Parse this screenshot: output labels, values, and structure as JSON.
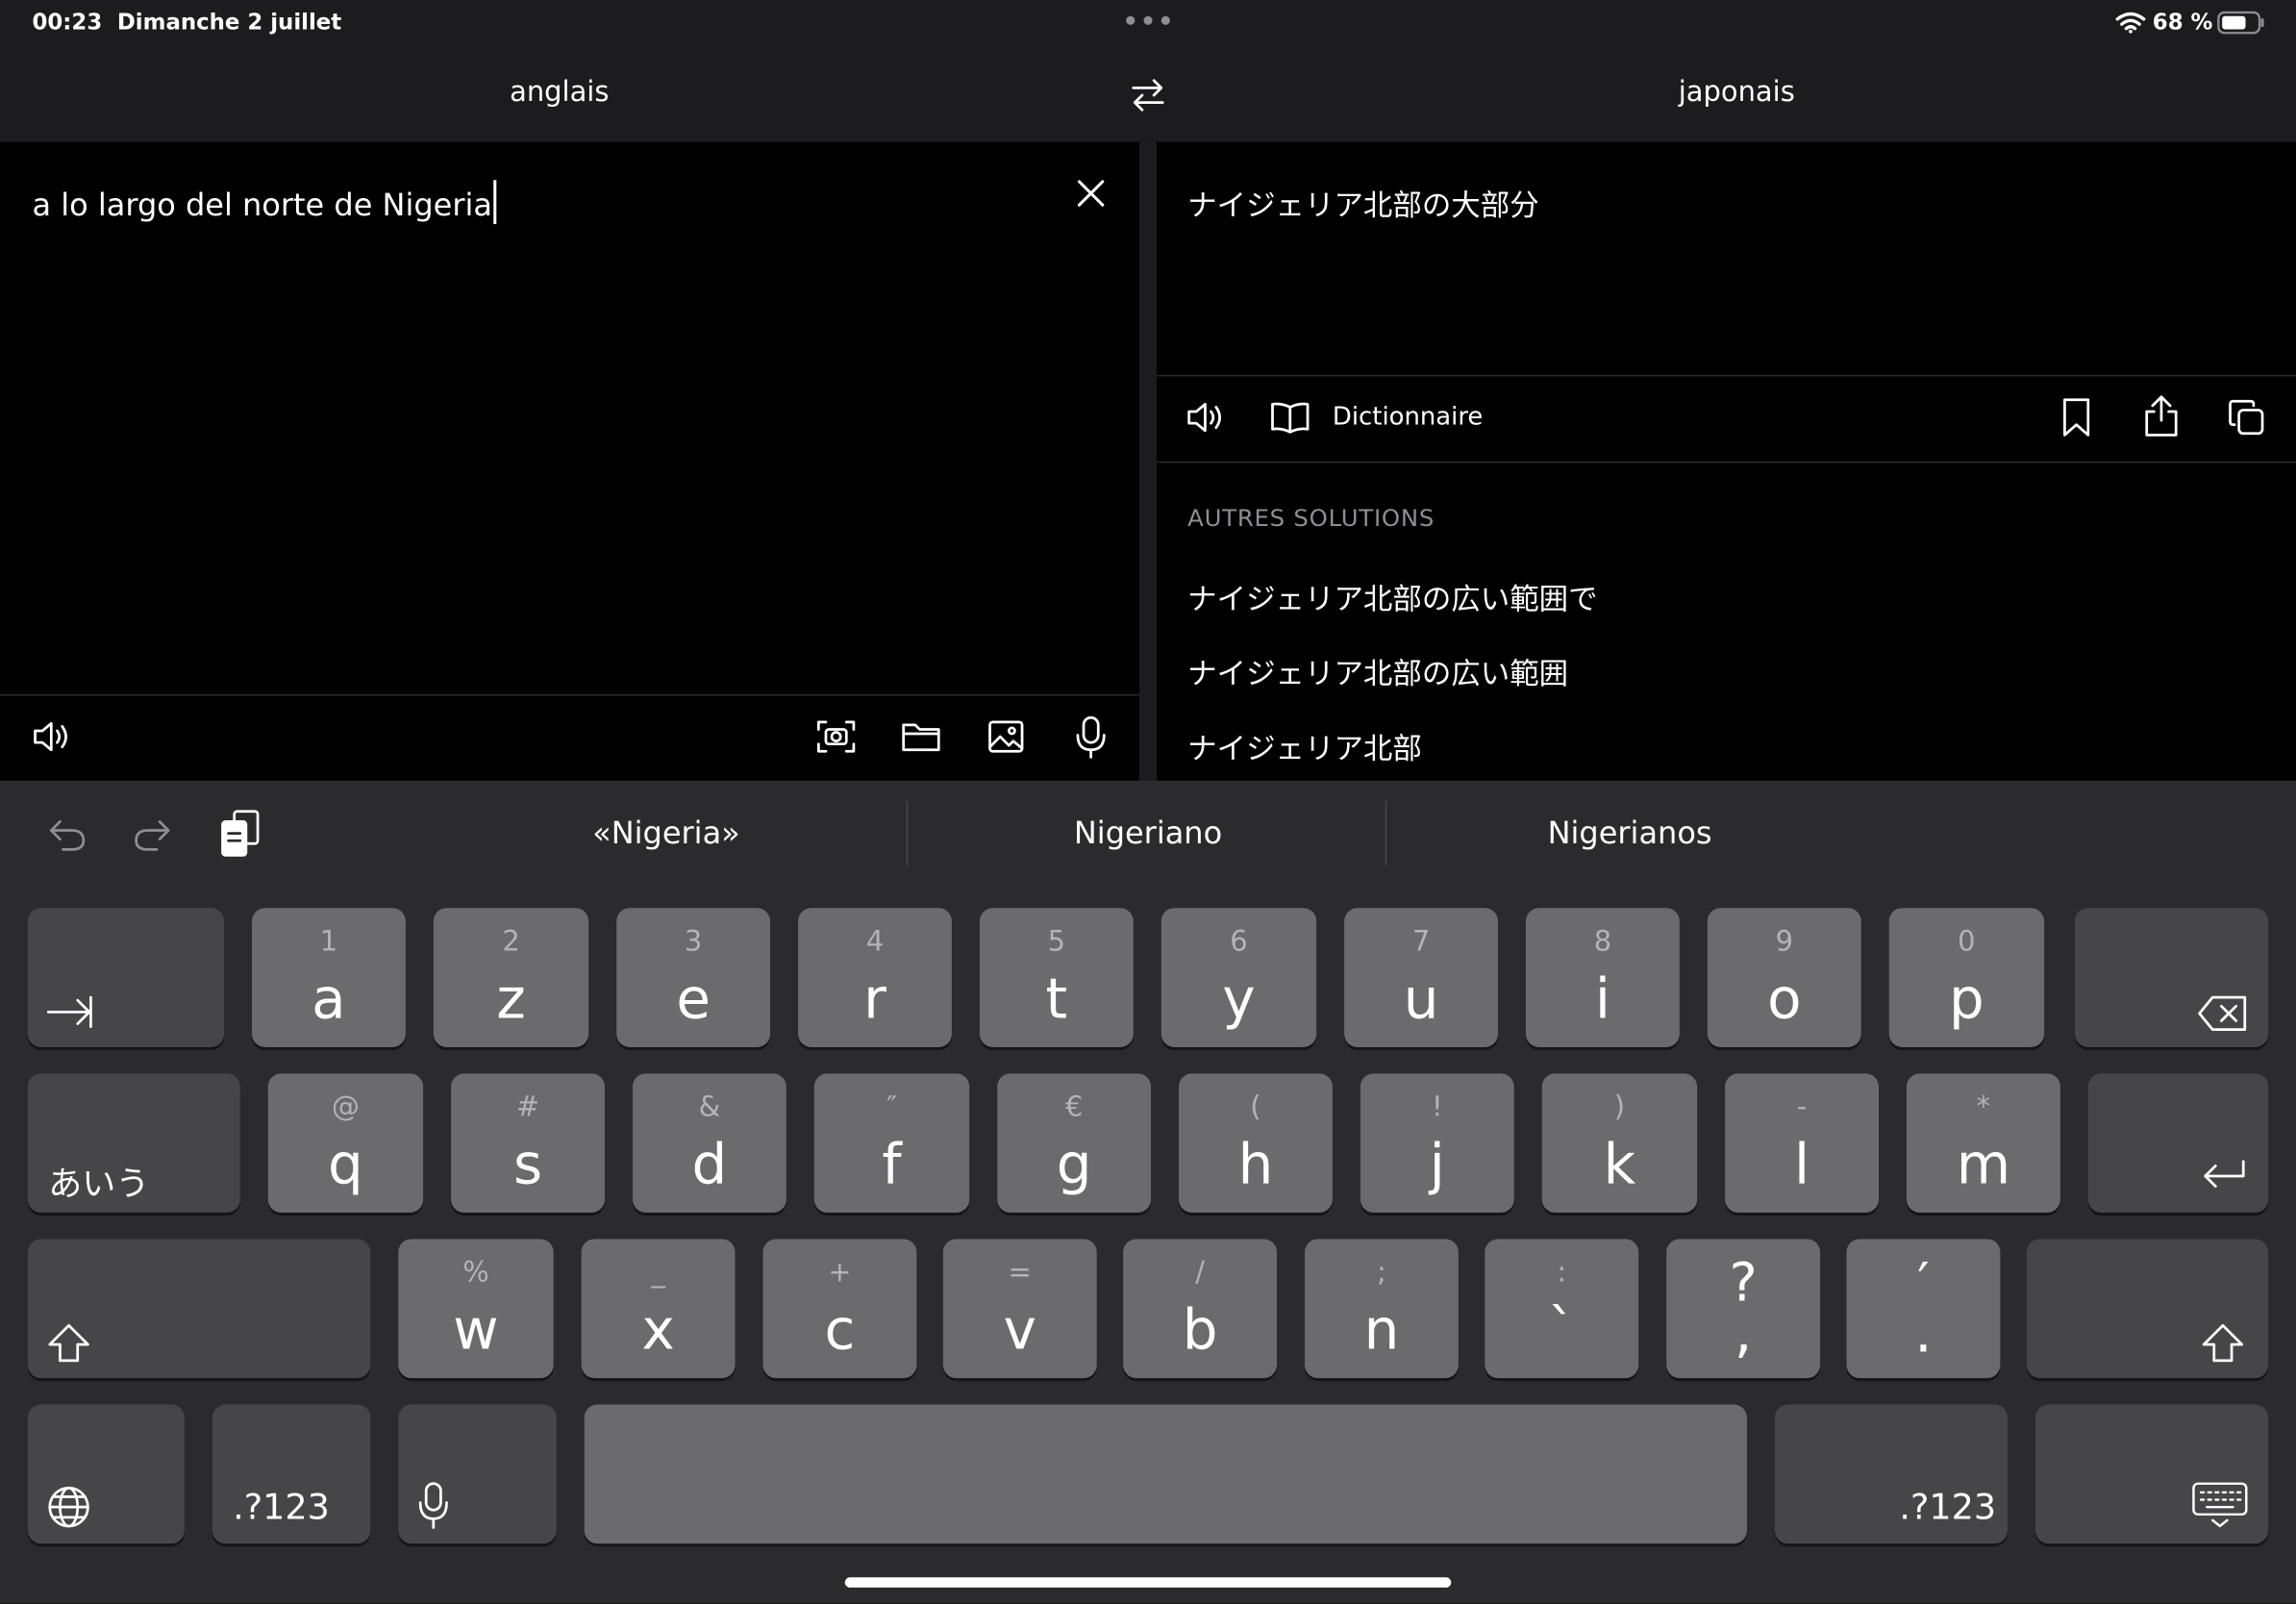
{
  "status": {
    "time": "00:23",
    "date": "Dimanche 2 juillet",
    "battery": "68 %"
  },
  "languages": {
    "source": "anglais",
    "target": "japonais"
  },
  "source_text": "a lo largo del norte de Nigeria",
  "translation": {
    "main": "ナイジェリア北部の大部分",
    "dictionary_label": "Dictionnaire",
    "other_header": "AUTRES SOLUTIONS",
    "alternatives": [
      "ナイジェリア北部の広い範囲で",
      "ナイジェリア北部の広い範囲",
      "ナイジェリア北部"
    ]
  },
  "keyboard": {
    "suggestions": [
      "«Nigeria»",
      "Nigeriano",
      "Nigerianos"
    ],
    "row1": [
      {
        "main": "a",
        "alt": "1"
      },
      {
        "main": "z",
        "alt": "2"
      },
      {
        "main": "e",
        "alt": "3"
      },
      {
        "main": "r",
        "alt": "4"
      },
      {
        "main": "t",
        "alt": "5"
      },
      {
        "main": "y",
        "alt": "6"
      },
      {
        "main": "u",
        "alt": "7"
      },
      {
        "main": "i",
        "alt": "8"
      },
      {
        "main": "o",
        "alt": "9"
      },
      {
        "main": "p",
        "alt": "0"
      }
    ],
    "row2": [
      {
        "main": "q",
        "alt": "@"
      },
      {
        "main": "s",
        "alt": "#"
      },
      {
        "main": "d",
        "alt": "&"
      },
      {
        "main": "f",
        "alt": "″"
      },
      {
        "main": "g",
        "alt": "€"
      },
      {
        "main": "h",
        "alt": "("
      },
      {
        "main": "j",
        "alt": "!"
      },
      {
        "main": "k",
        "alt": ")"
      },
      {
        "main": "l",
        "alt": "-"
      },
      {
        "main": "m",
        "alt": "*"
      }
    ],
    "row3": [
      {
        "main": "w",
        "alt": "%"
      },
      {
        "main": "x",
        "alt": "_"
      },
      {
        "main": "c",
        "alt": "+"
      },
      {
        "main": "v",
        "alt": "="
      },
      {
        "main": "b",
        "alt": "/"
      },
      {
        "main": "n",
        "alt": ";"
      },
      {
        "main": "`",
        "alt": ":"
      },
      {
        "main": ",",
        "alt": "?"
      },
      {
        "main": ".",
        "alt": "′"
      }
    ],
    "kana_label": "あいう",
    "numbers_label": ".?123"
  },
  "icons": {
    "wifi": "wifi-icon",
    "battery": "battery-icon",
    "swap": "swap-languages-icon",
    "clear": "close-icon",
    "speaker": "speaker-icon",
    "camera": "camera-scan-icon",
    "folder": "folder-icon",
    "photo": "photo-icon",
    "mic": "microphone-icon",
    "book": "dictionary-book-icon",
    "bookmark": "bookmark-icon",
    "share": "share-icon",
    "copy": "copy-icon",
    "undo": "undo-icon",
    "redo": "redo-icon",
    "paste": "paste-icon",
    "tab": "tab-key-icon",
    "delete": "delete-key-icon",
    "return": "return-key-icon",
    "shift": "shift-key-icon",
    "globe": "globe-icon",
    "hide_keyboard": "hide-keyboard-icon"
  }
}
